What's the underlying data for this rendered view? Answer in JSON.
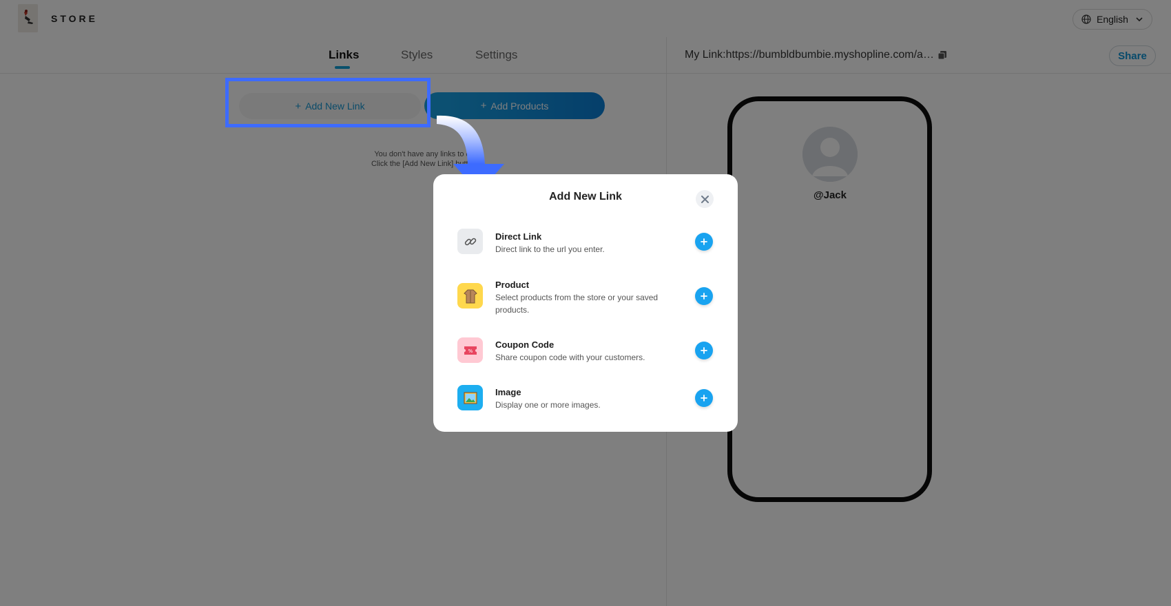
{
  "header": {
    "store_name": "STORE",
    "language": "English"
  },
  "tabs": [
    {
      "label": "Links",
      "active": true
    },
    {
      "label": "Styles",
      "active": false
    },
    {
      "label": "Settings",
      "active": false
    }
  ],
  "preview": {
    "my_link_label": "My Link:",
    "my_link_url": "https://bumbldbumbie.myshopline.com/a…",
    "share_label": "Share",
    "handle": "@Jack"
  },
  "actions": {
    "add_new_link": "Add New Link",
    "add_products": "Add Products"
  },
  "empty_state": {
    "line1": "You don't have any links to disp",
    "line2": "Click the [Add New Link] button a"
  },
  "modal": {
    "title": "Add New Link",
    "options": [
      {
        "title": "Direct Link",
        "desc": "Direct link to the url you enter.",
        "icon": "link-icon",
        "bg": "#e9ebee"
      },
      {
        "title": "Product",
        "desc": "Select products from the store or your saved products.",
        "icon": "product-icon",
        "bg": "#ffd84d"
      },
      {
        "title": "Coupon Code",
        "desc": "Share coupon code with your customers.",
        "icon": "coupon-icon",
        "bg": "#ffc9d3"
      },
      {
        "title": "Image",
        "desc": "Display one or more images.",
        "icon": "image-icon",
        "bg": "#1daef0"
      }
    ]
  },
  "colors": {
    "accent": "#19a3f0",
    "highlight": "#3d6bff",
    "overlay": "rgba(0,0,0,0.5)"
  }
}
